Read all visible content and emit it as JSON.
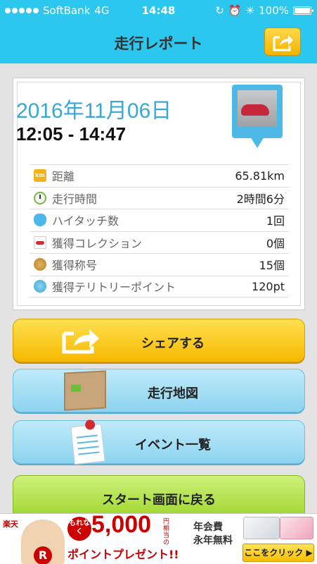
{
  "status_bar": {
    "carrier": "SoftBank",
    "network": "4G",
    "time": "14:48",
    "battery": "100%",
    "icons": [
      "signal-dots-icon",
      "orientation-lock-icon",
      "alarm-icon",
      "bluetooth-icon",
      "battery-icon"
    ]
  },
  "header": {
    "title": "走行レポート",
    "share_icon": "share-arrow-icon",
    "color": "#2cc7ee"
  },
  "report": {
    "date": "2016年11月06日",
    "time_range": "12:05 - 14:47",
    "photo_icon": "car-photo-pin-icon",
    "stats": [
      {
        "icon": "km-icon",
        "label": "距離",
        "value": "65.81km"
      },
      {
        "icon": "clock-icon",
        "label": "走行時間",
        "value": "2時間6分"
      },
      {
        "icon": "high-touch-hand-icon",
        "label": "ハイタッチ数",
        "value": "1回"
      },
      {
        "icon": "car-collection-icon",
        "label": "獲得コレクション",
        "value": "0個"
      },
      {
        "icon": "title-medal-icon",
        "label": "獲得称号",
        "value": "15個"
      },
      {
        "icon": "spot-icon",
        "label": "獲得テリトリーポイント",
        "value": "120pt"
      }
    ]
  },
  "buttons": {
    "share": "シェアする",
    "map": "走行地図",
    "events": "イベント一覧",
    "start": "スタート画面に戻る"
  },
  "ad": {
    "brand": "楽天",
    "badge": "もれなく",
    "amount": "5,000",
    "amount_suffix": "円相当の",
    "present": "ポイントプレゼント!!",
    "fee_line1": "年会費",
    "fee_line2": "永年無料",
    "cta": "ここをクリック ▶",
    "mascot_letter": "R"
  }
}
